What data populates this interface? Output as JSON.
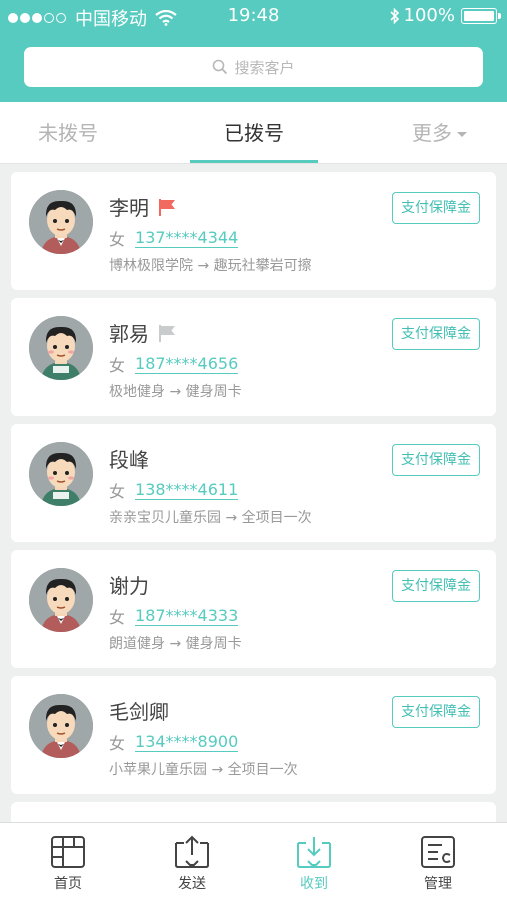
{
  "status_bar": {
    "carrier": "中国移动",
    "time": "19:48",
    "battery": "100%",
    "icons": [
      "signal-dots-icon",
      "wifi-icon",
      "bluetooth-icon",
      "battery-icon"
    ]
  },
  "search": {
    "placeholder": "搜索客户",
    "icon": "search-icon"
  },
  "tabs": [
    {
      "label": "未拨号",
      "active": false
    },
    {
      "label": "已拨号",
      "active": true
    },
    {
      "label": "更多",
      "active": false,
      "icon": "caret-down-icon"
    }
  ],
  "customers": [
    {
      "name": "李明",
      "flag": "red",
      "gender": "女",
      "phone": "137****4344",
      "route": "博林极限学院 → 趣玩社攀岩可擦",
      "action": "支付保障金"
    },
    {
      "name": "郭易",
      "flag": "gray",
      "gender": "女",
      "phone": "187****4656",
      "route": "极地健身 → 健身周卡",
      "action": "支付保障金"
    },
    {
      "name": "段峰",
      "flag": "none",
      "gender": "女",
      "phone": "138****4611",
      "route": "亲亲宝贝儿童乐园 → 全项目一次",
      "action": "支付保障金"
    },
    {
      "name": "谢力",
      "flag": "none",
      "gender": "女",
      "phone": "187****4333",
      "route": "朗道健身 → 健身周卡",
      "action": "支付保障金"
    },
    {
      "name": "毛剑卿",
      "flag": "none",
      "gender": "女",
      "phone": "134****8900",
      "route": "小苹果儿童乐园 → 全项目一次",
      "action": "支付保障金"
    }
  ],
  "bottom_nav": [
    {
      "label": "首页",
      "icon": "home-grid-icon",
      "active": false
    },
    {
      "label": "发送",
      "icon": "upload-icon",
      "active": false
    },
    {
      "label": "收到",
      "icon": "download-icon",
      "active": true
    },
    {
      "label": "管理",
      "icon": "manage-icon",
      "active": false
    }
  ],
  "colors": {
    "accent": "#57cbbf",
    "flag_red": "#f26a5f",
    "flag_gray": "#c9cccc",
    "background": "#eef0f0"
  }
}
